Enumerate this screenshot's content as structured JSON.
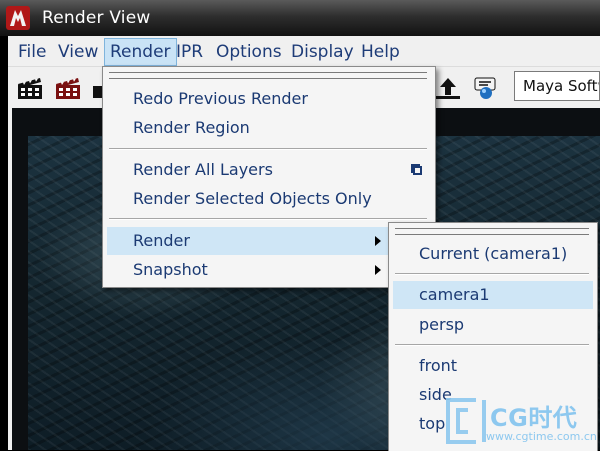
{
  "window": {
    "title": "Render View"
  },
  "menubar": {
    "items": [
      "File",
      "View",
      "Render",
      "IPR",
      "Options",
      "Display",
      "Help"
    ],
    "active": "Render"
  },
  "toolbar": {
    "icons": [
      "clapperboard-icon",
      "clapperboard-region-icon",
      "export-icon",
      "render-globals-icon"
    ],
    "renderer_dropdown": "Maya Softw"
  },
  "render_menu": {
    "items": [
      {
        "label": "Redo Previous Render"
      },
      {
        "label": "Render Region"
      },
      {
        "label": "Render All Layers",
        "option_box": true
      },
      {
        "label": "Render Selected Objects Only"
      },
      {
        "label": "Render",
        "submenu": true,
        "highlighted": true
      },
      {
        "label": "Snapshot",
        "submenu": true
      }
    ]
  },
  "camera_submenu": {
    "items": [
      {
        "label": "Current (camera1)"
      },
      {
        "label": "camera1",
        "highlighted": true
      },
      {
        "label": "persp"
      },
      {
        "label": "front"
      },
      {
        "label": "side"
      },
      {
        "label": "top"
      }
    ]
  },
  "watermark": {
    "brand": "CG时代",
    "url": "www.cgtime.com.cn"
  },
  "colors": {
    "menu_text": "#1b3a73",
    "highlight": "#cfe6f6",
    "watermark": "#8dc8ef"
  }
}
